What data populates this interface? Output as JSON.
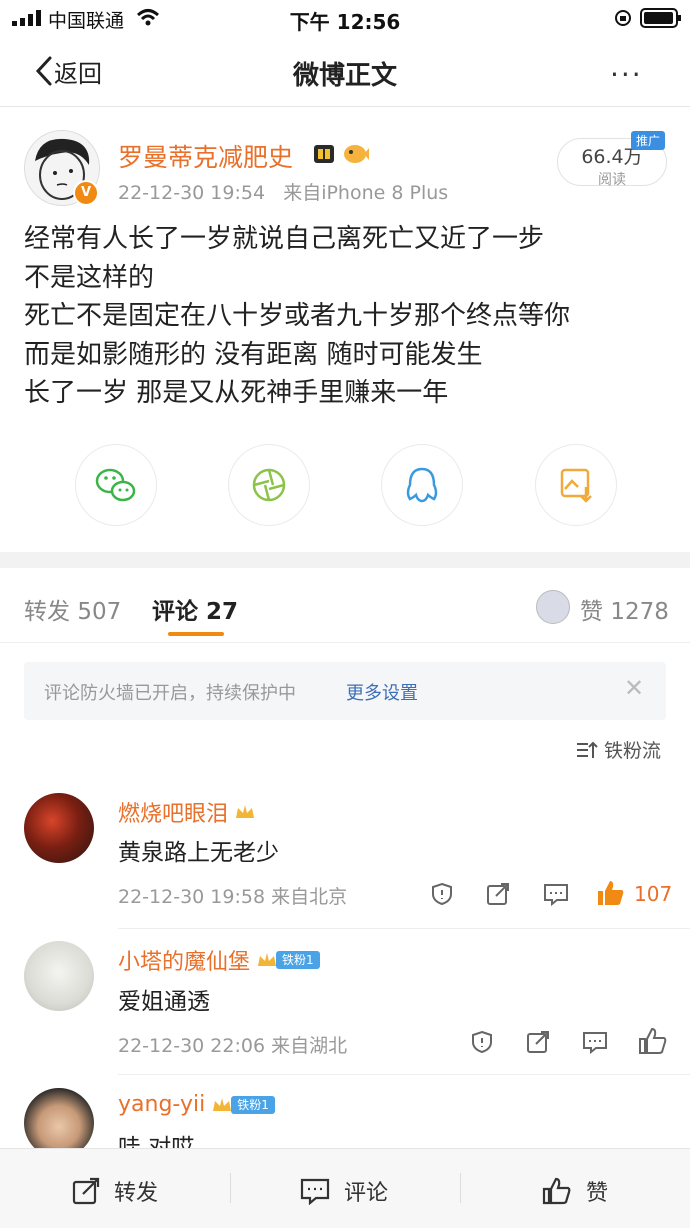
{
  "status_bar": {
    "carrier": "中国联通",
    "time": "下午 12:56"
  },
  "nav": {
    "back_label": "返回",
    "title": "微博正文",
    "more": "···"
  },
  "post": {
    "author": "罗曼蒂克减肥史",
    "timestamp": "22-12-30 19:54",
    "source": "来自iPhone 8 Plus",
    "views": "66.4万",
    "views_label": "阅读",
    "promo_badge": "推广",
    "verified_badge": "V",
    "lines": [
      "经常有人长了一岁就说自己离死亡又近了一步",
      "不是这样的",
      "死亡不是固定在八十岁或者九十岁那个终点等你",
      "而是如影随形的 没有距离 随时可能发生",
      "长了一岁 那是又从死神手里赚来一年"
    ]
  },
  "share_icons": [
    "wechat-icon",
    "moments-icon",
    "qq-icon",
    "save-image-icon"
  ],
  "tabs": {
    "repost_label": "转发",
    "repost_count": "507",
    "comment_label": "评论",
    "comment_count": "27",
    "like_label": "赞",
    "like_count": "1278"
  },
  "firewall": {
    "text": "评论防火墙已开启，持续保护中",
    "link": "更多设置"
  },
  "sort_label": "铁粉流",
  "comments": [
    {
      "name": "燃烧吧眼泪",
      "text": "黄泉路上无老少",
      "time": "22-12-30 19:58",
      "location": "来自北京",
      "likes": "107",
      "fan_badge": ""
    },
    {
      "name": "小塔的魔仙堡",
      "text": "爱姐通透",
      "time": "22-12-30 22:06",
      "location": "来自湖北",
      "likes": "",
      "fan_badge": "铁粉1"
    },
    {
      "name": "yang-yii",
      "text": "哇 对哎",
      "time": "",
      "location": "",
      "likes": "",
      "fan_badge": "铁粉1"
    }
  ],
  "bottom_bar": {
    "repost": "转发",
    "comment": "评论",
    "like": "赞"
  },
  "colors": {
    "accent": "#f08a13",
    "name": "#e8702a",
    "link": "#3e6fb6",
    "fan_badge": "#4aa3e6"
  }
}
